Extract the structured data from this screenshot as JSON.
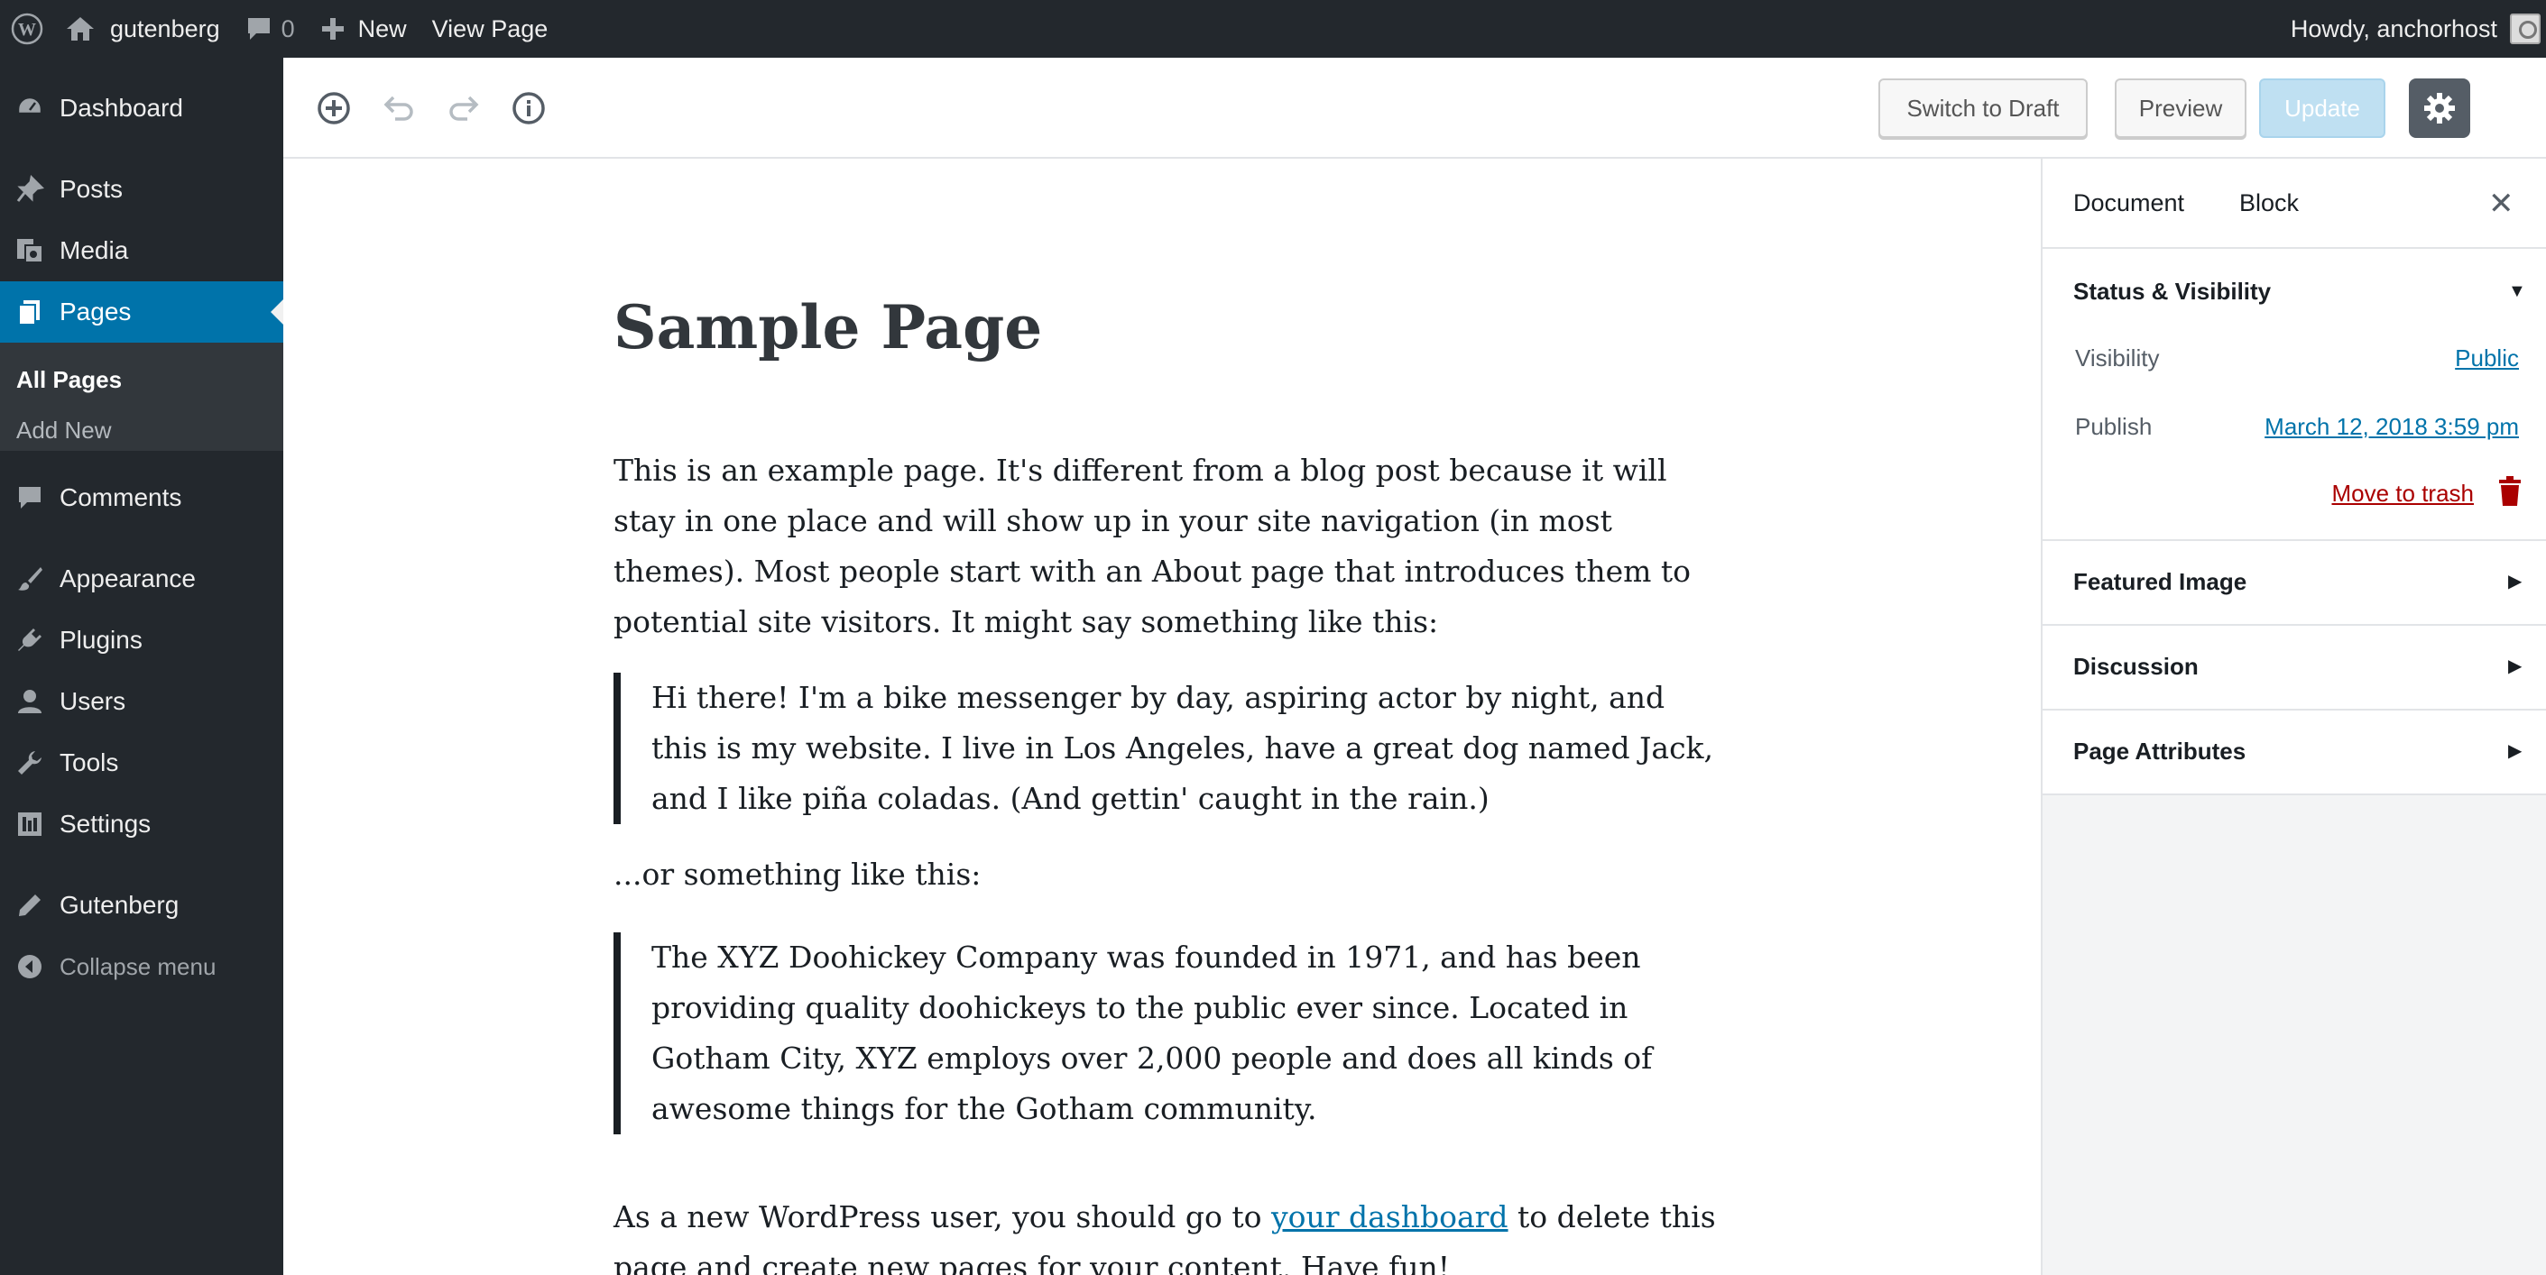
{
  "adminbar": {
    "site_name": "gutenberg",
    "comment_count": "0",
    "new_label": "New",
    "view_page": "View Page",
    "greeting": "Howdy, anchorhost"
  },
  "sidebar": {
    "items": [
      {
        "label": "Dashboard",
        "icon": "dashboard-icon"
      },
      {
        "label": "Posts",
        "icon": "pin-icon"
      },
      {
        "label": "Media",
        "icon": "media-icon"
      },
      {
        "label": "Pages",
        "icon": "pages-icon"
      },
      {
        "label": "Comments",
        "icon": "comment-icon"
      },
      {
        "label": "Appearance",
        "icon": "brush-icon"
      },
      {
        "label": "Plugins",
        "icon": "plug-icon"
      },
      {
        "label": "Users",
        "icon": "user-icon"
      },
      {
        "label": "Tools",
        "icon": "wrench-icon"
      },
      {
        "label": "Settings",
        "icon": "settings-icon"
      },
      {
        "label": "Gutenberg",
        "icon": "pencil-icon"
      }
    ],
    "submenu": [
      "All Pages",
      "Add New"
    ],
    "collapse": "Collapse menu"
  },
  "toolbar": {
    "switch_draft": "Switch to Draft",
    "preview": "Preview",
    "update": "Update"
  },
  "content": {
    "title": "Sample Page",
    "p1": "This is an example page. It's different from a blog post because it will stay in one place and will show up in your site navigation (in most themes). Most people start with an About page that introduces them to potential site visitors. It might say something like this:",
    "q1": "Hi there! I'm a bike messenger by day, aspiring actor by night, and this is my website. I live in Los Angeles, have a great dog named Jack, and I like piña coladas. (And gettin' caught in the rain.)",
    "p2": "...or something like this:",
    "q2": "The XYZ Doohickey Company was founded in 1971, and has been providing quality doohickeys to the public ever since. Located in Gotham City, XYZ employs over 2,000 people and does all kinds of awesome things for the Gotham community.",
    "p3_before": "As a new WordPress user, you should go to ",
    "p3_link": "your dashboard",
    "p3_after": " to delete this page and create new pages for your content. Have fun!"
  },
  "settings": {
    "tab_document": "Document",
    "tab_block": "Block",
    "status_title": "Status & Visibility",
    "visibility_label": "Visibility",
    "visibility_value": "Public",
    "publish_label": "Publish",
    "publish_value": "March 12, 2018 3:59 pm",
    "trash_label": "Move to trash",
    "featured_image": "Featured Image",
    "discussion": "Discussion",
    "page_attributes": "Page Attributes"
  },
  "colors": {
    "adminbar_bg": "#23282d",
    "accent": "#0073aa",
    "trash": "#a00000"
  }
}
